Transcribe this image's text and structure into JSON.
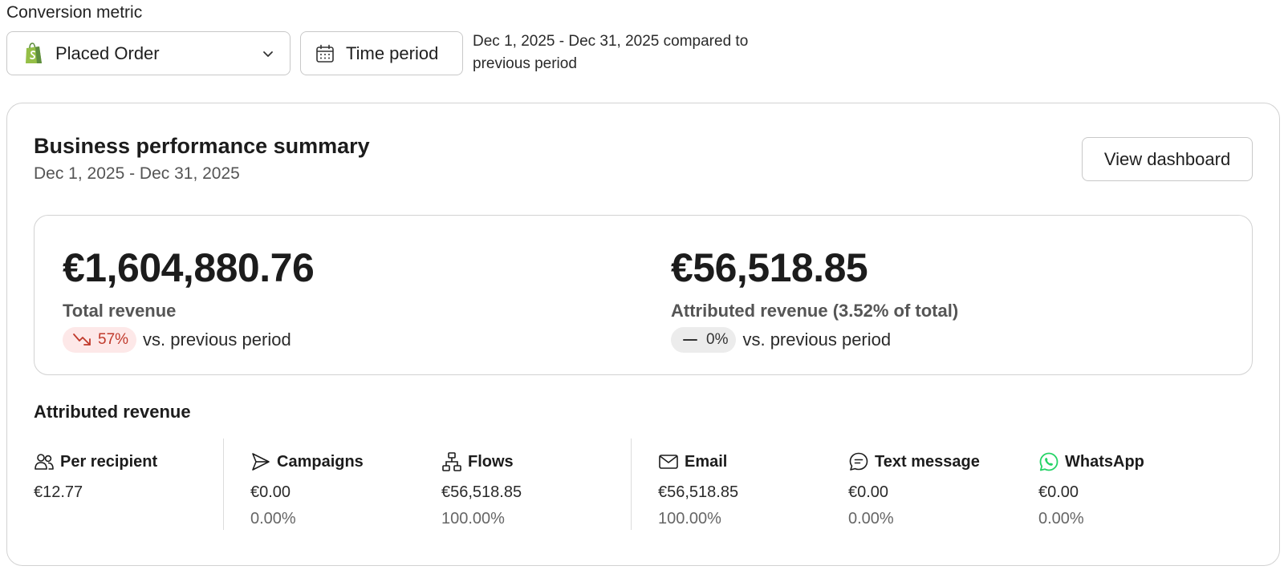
{
  "metric": {
    "label": "Conversion metric",
    "selected": "Placed Order"
  },
  "time": {
    "button_label": "Time period",
    "description": "Dec 1, 2025 - Dec 31, 2025 compared to previous period"
  },
  "card": {
    "title": "Business performance summary",
    "subtitle": "Dec 1, 2025 - Dec 31, 2025",
    "view_button": "View dashboard"
  },
  "summary": {
    "total": {
      "value": "€1,604,880.76",
      "label": "Total revenue",
      "change": "57%",
      "vs": "vs. previous period"
    },
    "attributed": {
      "value": "€56,518.85",
      "label": "Attributed revenue (3.52% of total)",
      "change": "0%",
      "vs": "vs. previous period"
    }
  },
  "attributed_section": {
    "title": "Attributed revenue",
    "columns": [
      {
        "label": "Per recipient",
        "value": "€12.77",
        "pct": ""
      },
      {
        "label": "Campaigns",
        "value": "€0.00",
        "pct": "0.00%"
      },
      {
        "label": "Flows",
        "value": "€56,518.85",
        "pct": "100.00%"
      },
      {
        "label": "Email",
        "value": "€56,518.85",
        "pct": "100.00%"
      },
      {
        "label": "Text message",
        "value": "€0.00",
        "pct": "0.00%"
      },
      {
        "label": "WhatsApp",
        "value": "€0.00",
        "pct": "0.00%"
      }
    ]
  },
  "colors": {
    "shopify_green": "#95bf47",
    "shopify_dark": "#5e8e3e",
    "negative": "#c0392b",
    "negative_bg": "#fde8e8",
    "neutral_bg": "#ececec",
    "whatsapp": "#25d366"
  },
  "icons": {
    "metric": "shopify-bag-icon",
    "dropdown": "chevron-down-icon",
    "time": "calendar-icon",
    "down": "trending-down-icon",
    "flat": "minus-icon",
    "per_recipient": "users-icon",
    "campaigns": "send-icon",
    "flows": "flow-icon",
    "email": "mail-icon",
    "text_message": "chat-icon",
    "whatsapp": "whatsapp-icon"
  }
}
